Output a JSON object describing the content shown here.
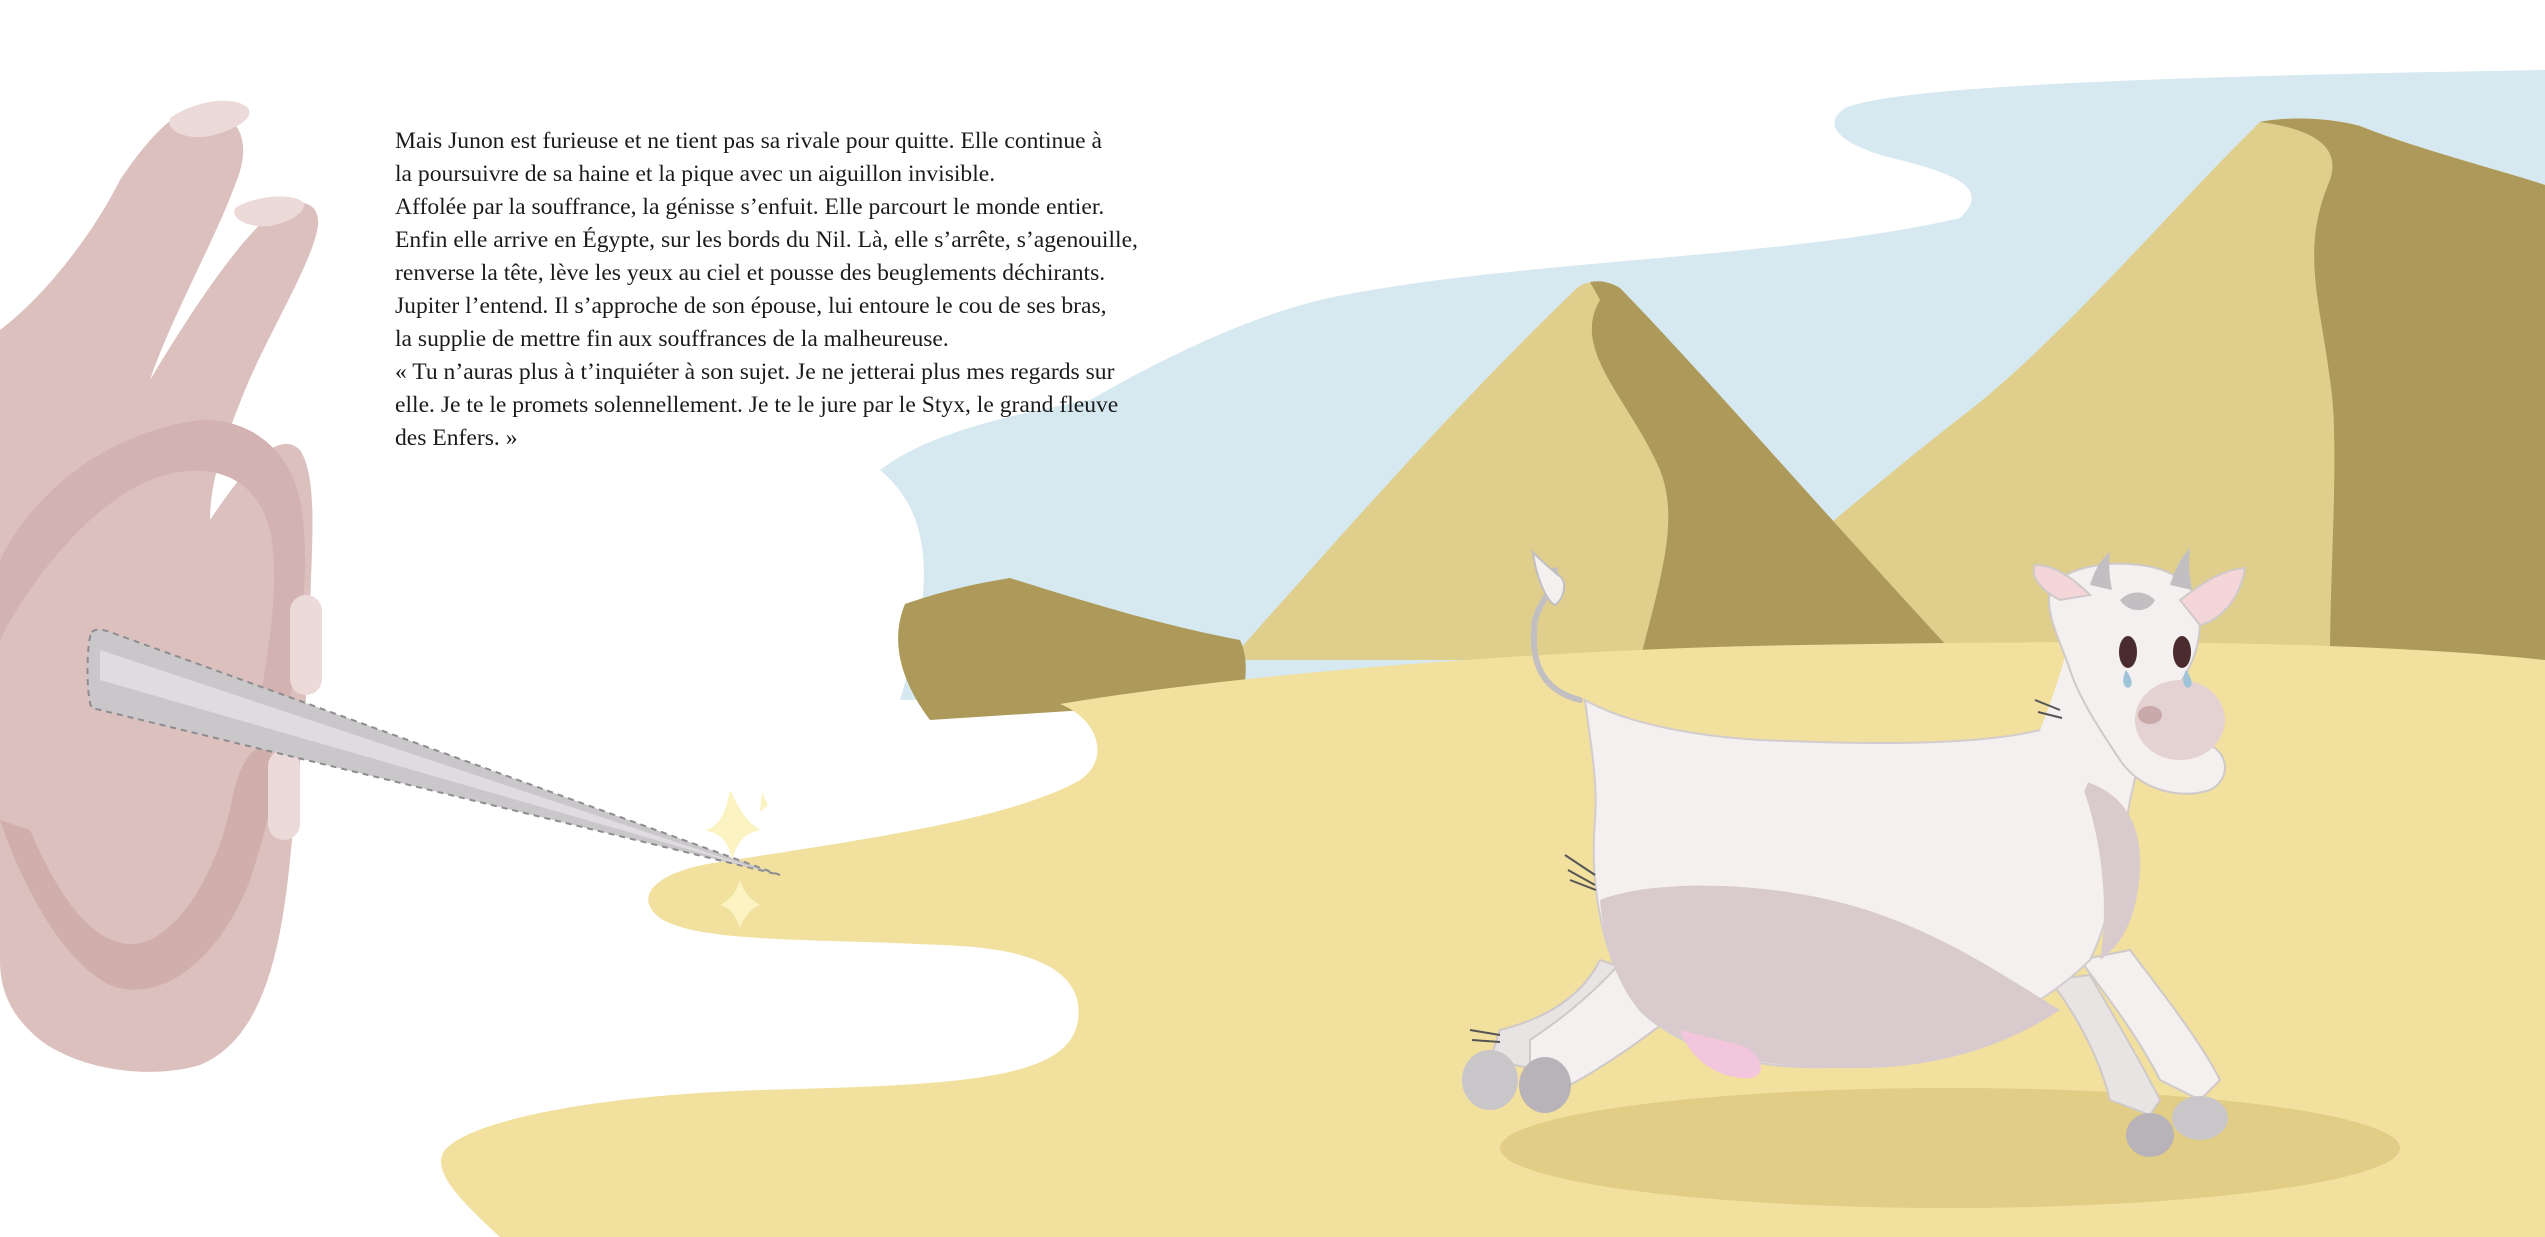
{
  "story": {
    "lines": [
      "Mais Junon est furieuse et ne tient pas sa rivale pour quitte. Elle continue à",
      "la poursuivre de sa haine et la pique avec un aiguillon invisible.",
      "Affolée par la souffrance, la génisse s’enfuit. Elle parcourt le monde entier.",
      "Enfin elle arrive en Égypte, sur les bords du Nil. Là, elle s’arrête, s’agenouille,",
      "renverse la tête, lève les yeux au ciel et pousse des beuglements déchirants.",
      "Jupiter l’entend. Il s’approche de son épouse, lui entoure le cou de ses bras,",
      "la supplie de mettre fin aux souffrances de la malheureuse.",
      "« Tu n’auras plus à t’inquiéter à son sujet. Je ne jetterai plus mes regards sur",
      "elle. Je te le promets solennellement. Je te le jure par le Styx, le grand fleuve",
      "des Enfers. »"
    ]
  },
  "palette": {
    "sky": "#d6e8f0",
    "sand_light": "#f2e09e",
    "sand_shadow": "#e1cd85",
    "pyramid_light": "#e0cf8c",
    "pyramid_dark": "#ad9a5a",
    "hand": "#dcc0be",
    "needle": "#c9c7c9",
    "cow_body": "#f4f0f0",
    "cow_belly": "#d9cbcd",
    "udder": "#f2c6dc"
  },
  "icons": {
    "hand": "hand-illustration",
    "needle": "needle-illustration",
    "cow": "cow-illustration"
  }
}
